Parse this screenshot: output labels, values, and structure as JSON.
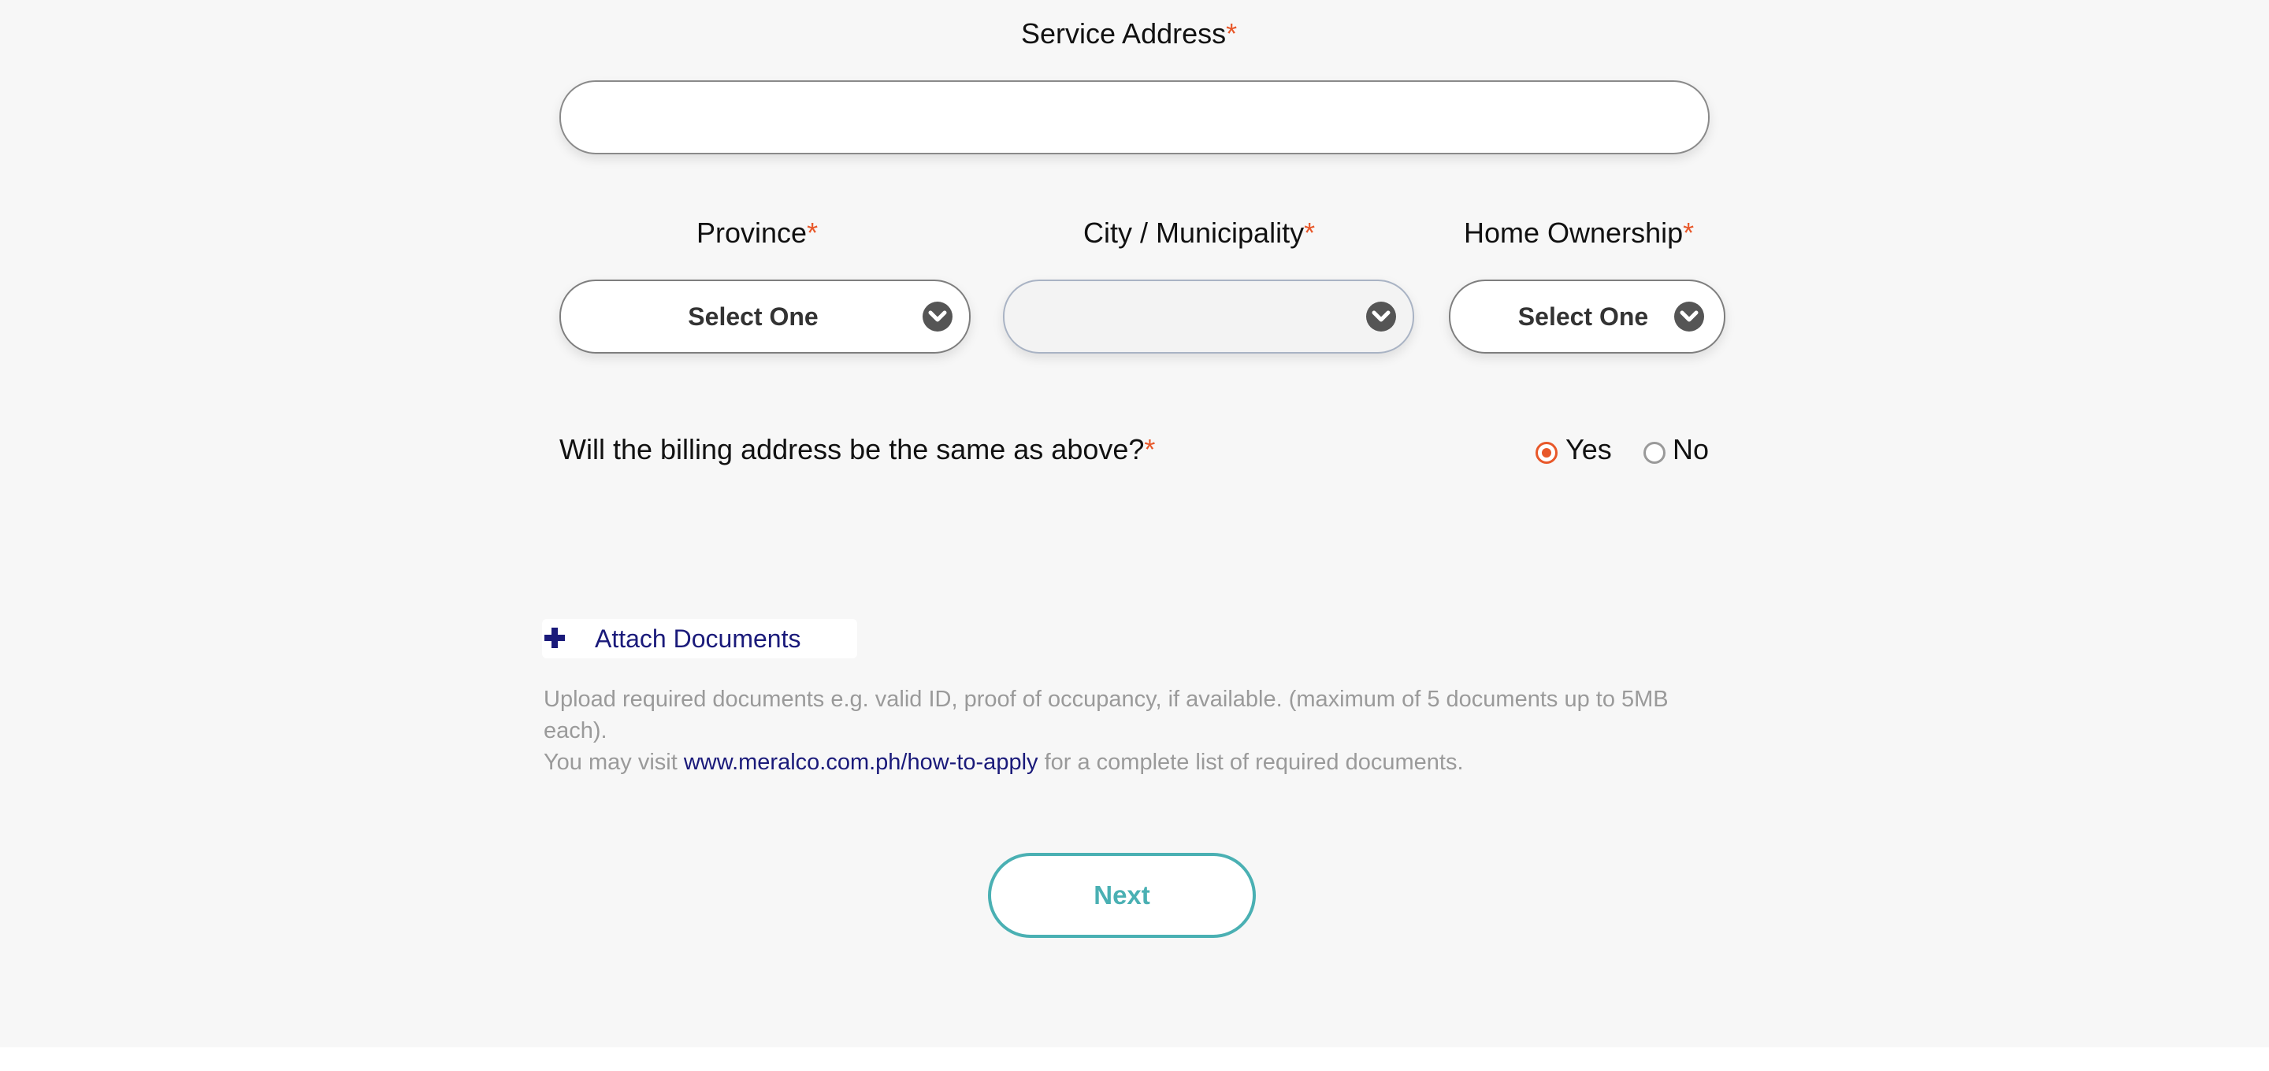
{
  "form": {
    "service_address": {
      "label": "Service Address",
      "required_mark": "*",
      "value": ""
    },
    "province": {
      "label": "Province",
      "required_mark": "*",
      "selected": "Select One"
    },
    "city": {
      "label": "City / Municipality",
      "required_mark": "*",
      "selected": ""
    },
    "home_ownership": {
      "label": "Home Ownership",
      "required_mark": "*",
      "selected": "Select One"
    },
    "billing_same": {
      "question": "Will the billing address be the same as above?",
      "required_mark": "*",
      "options": [
        {
          "label": "Yes",
          "checked": true
        },
        {
          "label": "No",
          "checked": false
        }
      ]
    }
  },
  "attach": {
    "label": "Attach Documents"
  },
  "help": {
    "line1": "Upload required documents e.g. valid ID, proof of occupancy, if available. (maximum of 5 documents up to 5MB each).",
    "line2_prefix": "You may visit ",
    "link_text": "www.meralco.com.ph/how-to-apply",
    "line2_suffix": " for a complete list of required documents."
  },
  "actions": {
    "next_label": "Next"
  },
  "colors": {
    "required": "#e8582a",
    "link": "#1a1a7a",
    "primary_teal": "#4ab0b3",
    "background": "#f7f7f7"
  }
}
